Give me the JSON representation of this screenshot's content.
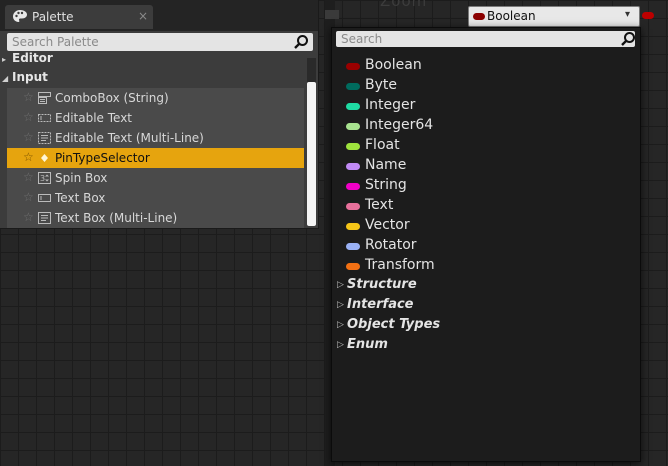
{
  "palette": {
    "tab_title": "Palette",
    "close_glyph": "×",
    "search_placeholder": "Search Palette",
    "categories": [
      "Editor",
      "Input"
    ],
    "category_arrows": [
      "▸",
      "◢"
    ],
    "items": [
      {
        "label": "ComboBox (String)",
        "icon": "combobox-icon",
        "selected": false
      },
      {
        "label": "Editable Text",
        "icon": "editable-text-icon",
        "selected": false
      },
      {
        "label": "Editable Text (Multi-Line)",
        "icon": "editable-text-multiline-icon",
        "selected": false
      },
      {
        "label": "PinTypeSelector",
        "icon": "pin-type-selector-icon",
        "selected": true
      },
      {
        "label": "Spin Box",
        "icon": "spin-box-icon",
        "selected": false
      },
      {
        "label": "Text Box",
        "icon": "text-box-icon",
        "selected": false
      },
      {
        "label": "Text Box (Multi-Line)",
        "icon": "text-box-multiline-icon",
        "selected": false
      }
    ],
    "star_glyph": "☆",
    "selected_color": "#e6a40e"
  },
  "background": {
    "zoom_text": "Zoom"
  },
  "combo": {
    "value": "Boolean",
    "pill_color": "#8b0000",
    "chevron": "▾"
  },
  "type_menu": {
    "search_placeholder": "Search",
    "types": [
      {
        "label": "Boolean",
        "color": "#9a0000"
      },
      {
        "label": "Byte",
        "color": "#006b5e"
      },
      {
        "label": "Integer",
        "color": "#1fdba3"
      },
      {
        "label": "Integer64",
        "color": "#a8e28f"
      },
      {
        "label": "Float",
        "color": "#9ee23d"
      },
      {
        "label": "Name",
        "color": "#c18af5"
      },
      {
        "label": "String",
        "color": "#f000c6"
      },
      {
        "label": "Text",
        "color": "#e8709b"
      },
      {
        "label": "Vector",
        "color": "#f5c518"
      },
      {
        "label": "Rotator",
        "color": "#9ab1f5"
      },
      {
        "label": "Transform",
        "color": "#f27013"
      }
    ],
    "groups": [
      {
        "label": "Structure"
      },
      {
        "label": "Interface"
      },
      {
        "label": "Object Types"
      },
      {
        "label": "Enum"
      }
    ],
    "group_arrow": "▷"
  }
}
